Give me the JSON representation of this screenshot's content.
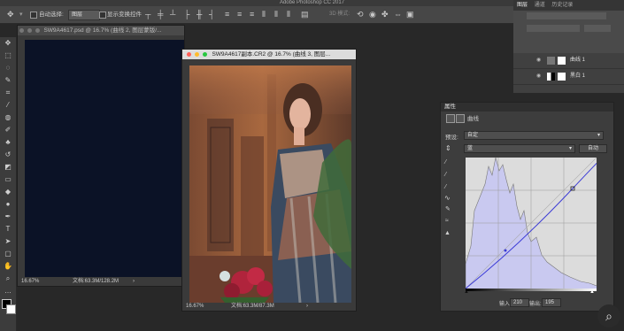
{
  "app": {
    "title": "Adobe Photoshop CC 2017"
  },
  "options_bar": {
    "auto_select_label": "自动选择:",
    "auto_select_value": "图层",
    "show_transform_label": "显示变换控件",
    "mode_3d_label": "3D 模式:"
  },
  "doc1": {
    "title": "SW9A4617.psd @ 16.7% (曲线 2, 图层蒙版/...",
    "zoom": "16.67%",
    "doc_size": "文档:63.3M/128.2M"
  },
  "doc2": {
    "title": "SW9A4617副本.CR2 @ 16.7% (曲线 3, 图层...",
    "zoom": "16.67%",
    "doc_size": "文档:63.3M/87.3M"
  },
  "layers_panel": {
    "tabs": [
      "图层",
      "通道",
      "历史记录"
    ],
    "layers": [
      {
        "name": "曲线 1"
      },
      {
        "name": "黑白 1"
      }
    ]
  },
  "properties": {
    "title": "属性",
    "adjustment": "曲线",
    "preset_label": "预设:",
    "preset_value": "自定",
    "channel_value": "蓝",
    "auto_label": "自动",
    "input_label": "输入:",
    "input_value": "210",
    "output_label": "输出:",
    "output_value": "195"
  },
  "icons": {
    "search": "magnifier-icon"
  }
}
